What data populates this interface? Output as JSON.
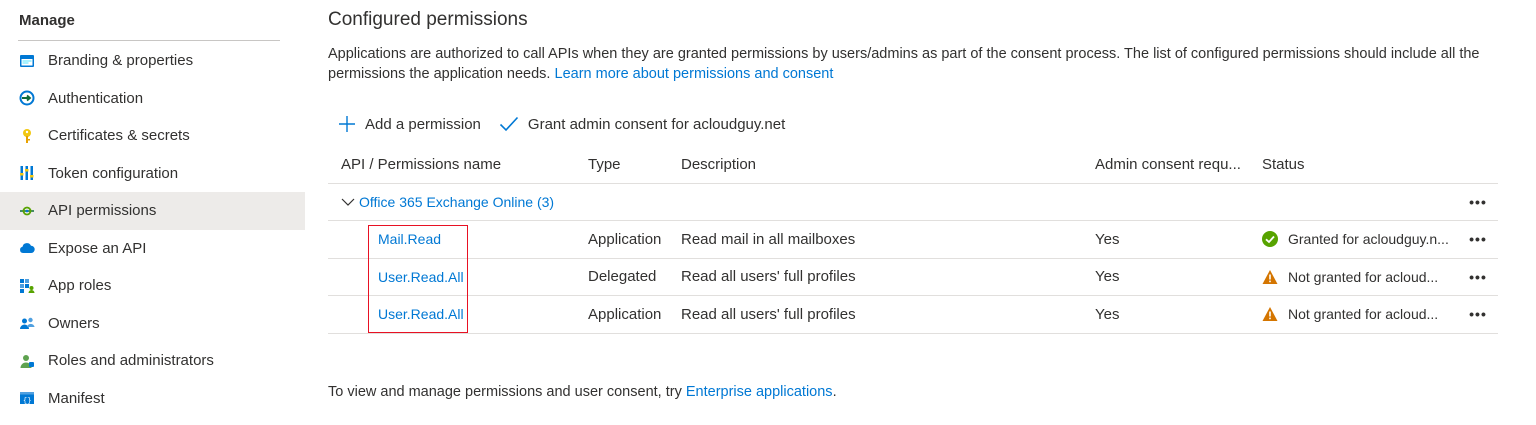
{
  "sidebar": {
    "section_title": "Manage",
    "items": [
      {
        "label": "Branding & properties",
        "icon": "branding-icon",
        "color": "#0078d4"
      },
      {
        "label": "Authentication",
        "icon": "authentication-icon",
        "color": "#0078d4"
      },
      {
        "label": "Certificates & secrets",
        "icon": "key-icon",
        "color": "#f2c811"
      },
      {
        "label": "Token configuration",
        "icon": "token-config-icon",
        "color": "#0078d4"
      },
      {
        "label": "API permissions",
        "icon": "api-permissions-icon",
        "color": "#0078d4",
        "active": true
      },
      {
        "label": "Expose an API",
        "icon": "cloud-icon",
        "color": "#0078d4"
      },
      {
        "label": "App roles",
        "icon": "app-roles-icon",
        "color": "#0078d4"
      },
      {
        "label": "Owners",
        "icon": "owners-icon",
        "color": "#0078d4"
      },
      {
        "label": "Roles and administrators",
        "icon": "roles-admin-icon",
        "color": "#5ea24f"
      },
      {
        "label": "Manifest",
        "icon": "manifest-icon",
        "color": "#0078d4"
      }
    ]
  },
  "main": {
    "title": "Configured permissions",
    "description": "Applications are authorized to call APIs when they are granted permissions by users/admins as part of the consent process. The list of configured permissions should include all the permissions the application needs.",
    "description_link": "Learn more about permissions and consent",
    "toolbar": {
      "add_label": "Add a permission",
      "grant_label": "Grant admin consent for acloudguy.net"
    },
    "table": {
      "headers": {
        "name": "API / Permissions name",
        "type": "Type",
        "description": "Description",
        "admin": "Admin consent requ...",
        "status": "Status"
      },
      "group": {
        "label": "Office 365 Exchange Online (3)"
      },
      "rows": [
        {
          "name": "Mail.Read",
          "type": "Application",
          "description": "Read mail in all mailboxes",
          "admin": "Yes",
          "status": "Granted for acloudguy.n...",
          "status_kind": "granted"
        },
        {
          "name": "User.Read.All",
          "type": "Delegated",
          "description": "Read all users' full profiles",
          "admin": "Yes",
          "status": "Not granted for acloud...",
          "status_kind": "warning"
        },
        {
          "name": "User.Read.All",
          "type": "Application",
          "description": "Read all users' full profiles",
          "admin": "Yes",
          "status": "Not granted for acloud...",
          "status_kind": "warning"
        }
      ],
      "more_label": "•••"
    },
    "footer": {
      "text": "To view and manage permissions and user consent, try",
      "link": "Enterprise applications",
      "suffix": "."
    }
  },
  "colors": {
    "accent": "#0078d4",
    "granted": "#57a300",
    "warning": "#d47500",
    "highlight_box": "#e81123"
  }
}
